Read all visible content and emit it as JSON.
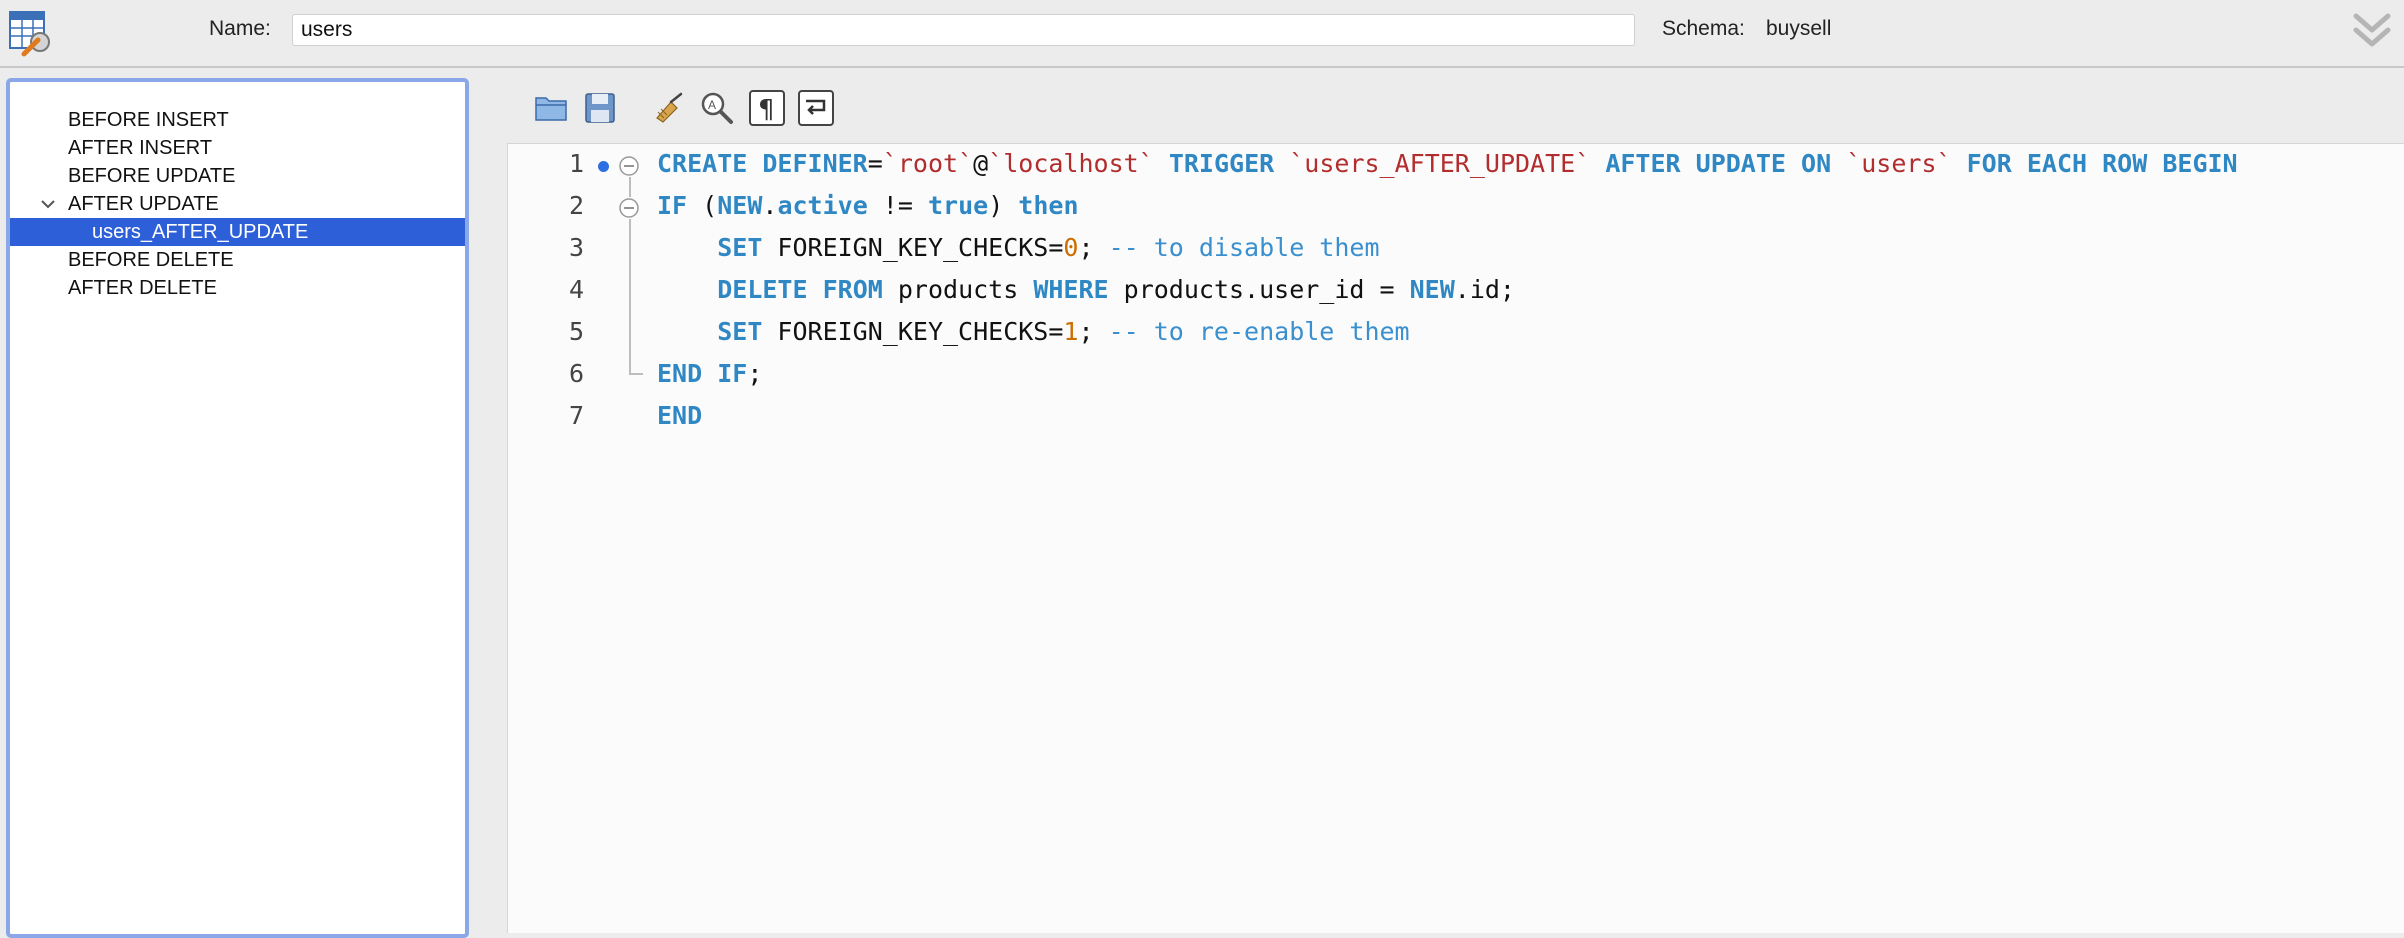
{
  "header": {
    "name_label": "Name:",
    "name_value": "users",
    "schema_label": "Schema:",
    "schema_value": "buysell"
  },
  "tree": {
    "items": [
      {
        "label": "BEFORE INSERT"
      },
      {
        "label": "AFTER INSERT"
      },
      {
        "label": "BEFORE UPDATE"
      },
      {
        "label": "AFTER UPDATE",
        "expanded": true
      },
      {
        "label": "users_AFTER_UPDATE",
        "selected": true
      },
      {
        "label": "BEFORE DELETE"
      },
      {
        "label": "AFTER DELETE"
      }
    ]
  },
  "toolbar": {
    "icons": [
      "open-folder-icon",
      "save-icon",
      "beautify-icon",
      "find-icon",
      "invisibles-icon",
      "word-wrap-icon"
    ]
  },
  "editor": {
    "line_numbers": [
      "1",
      "2",
      "3",
      "4",
      "5",
      "6",
      "7"
    ],
    "lines": [
      [
        {
          "t": "CREATE",
          "c": "kw"
        },
        {
          "t": " ",
          "c": "plain"
        },
        {
          "t": "DEFINER",
          "c": "kw"
        },
        {
          "t": "=",
          "c": "plain"
        },
        {
          "t": "`root`",
          "c": "str"
        },
        {
          "t": "@",
          "c": "plain"
        },
        {
          "t": "`localhost`",
          "c": "str"
        },
        {
          "t": " ",
          "c": "plain"
        },
        {
          "t": "TRIGGER",
          "c": "kw"
        },
        {
          "t": " ",
          "c": "plain"
        },
        {
          "t": "`users_AFTER_UPDATE`",
          "c": "str"
        },
        {
          "t": " ",
          "c": "plain"
        },
        {
          "t": "AFTER",
          "c": "kw"
        },
        {
          "t": " ",
          "c": "plain"
        },
        {
          "t": "UPDATE",
          "c": "kw"
        },
        {
          "t": " ",
          "c": "plain"
        },
        {
          "t": "ON",
          "c": "kw"
        },
        {
          "t": " ",
          "c": "plain"
        },
        {
          "t": "`users`",
          "c": "str"
        },
        {
          "t": " ",
          "c": "plain"
        },
        {
          "t": "FOR",
          "c": "kw"
        },
        {
          "t": " ",
          "c": "plain"
        },
        {
          "t": "EACH",
          "c": "kw"
        },
        {
          "t": " ",
          "c": "plain"
        },
        {
          "t": "ROW",
          "c": "kw"
        },
        {
          "t": " ",
          "c": "plain"
        },
        {
          "t": "BEGIN",
          "c": "kw"
        }
      ],
      [
        {
          "t": "IF",
          "c": "kw"
        },
        {
          "t": " (",
          "c": "plain"
        },
        {
          "t": "NEW",
          "c": "kw"
        },
        {
          "t": ".",
          "c": "plain"
        },
        {
          "t": "active",
          "c": "kw"
        },
        {
          "t": " != ",
          "c": "plain"
        },
        {
          "t": "true",
          "c": "kw"
        },
        {
          "t": ") ",
          "c": "plain"
        },
        {
          "t": "then",
          "c": "kw"
        }
      ],
      [
        {
          "t": "    ",
          "c": "plain"
        },
        {
          "t": "SET",
          "c": "kw"
        },
        {
          "t": " FOREIGN_KEY_CHECKS=",
          "c": "plain"
        },
        {
          "t": "0",
          "c": "num"
        },
        {
          "t": "; ",
          "c": "plain"
        },
        {
          "t": "-- to disable them",
          "c": "cmt"
        }
      ],
      [
        {
          "t": "    ",
          "c": "plain"
        },
        {
          "t": "DELETE",
          "c": "kw"
        },
        {
          "t": " ",
          "c": "plain"
        },
        {
          "t": "FROM",
          "c": "kw"
        },
        {
          "t": " products ",
          "c": "plain"
        },
        {
          "t": "WHERE",
          "c": "kw"
        },
        {
          "t": " products.user_id = ",
          "c": "plain"
        },
        {
          "t": "NEW",
          "c": "kw"
        },
        {
          "t": ".id;",
          "c": "plain"
        }
      ],
      [
        {
          "t": "    ",
          "c": "plain"
        },
        {
          "t": "SET",
          "c": "kw"
        },
        {
          "t": " FOREIGN_KEY_CHECKS=",
          "c": "plain"
        },
        {
          "t": "1",
          "c": "num"
        },
        {
          "t": "; ",
          "c": "plain"
        },
        {
          "t": "-- to re-enable them",
          "c": "cmt"
        }
      ],
      [
        {
          "t": "END",
          "c": "kw"
        },
        {
          "t": " ",
          "c": "plain"
        },
        {
          "t": "IF",
          "c": "kw"
        },
        {
          "t": ";",
          "c": "plain"
        }
      ],
      [
        {
          "t": "END",
          "c": "kw"
        }
      ]
    ]
  },
  "colors": {
    "selection": "#2d5fd9",
    "keyword": "#2f87c4",
    "string": "#b22d2d",
    "number": "#cc6e00",
    "comment": "#3a8fcf",
    "tree_focus_border": "#8aa7e8"
  }
}
